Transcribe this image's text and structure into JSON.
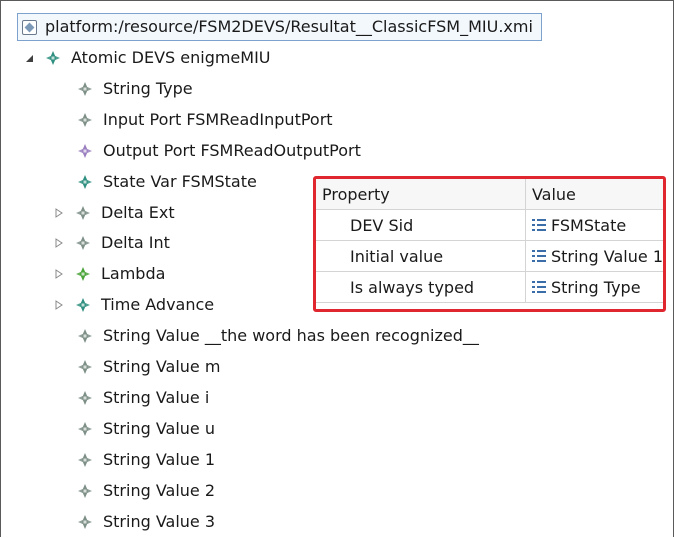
{
  "resource": {
    "icon": "resource-file-icon",
    "label": "platform:/resource/FSM2DEVS/Resultat__ClassicFSM_MIU.xmi"
  },
  "tree": {
    "root": {
      "twisty": "expanded",
      "icon": "diamond-node-icon",
      "label": "Atomic DEVS enigmeMIU"
    },
    "children": [
      {
        "twisty": "none",
        "icon": "diamond-node-icon",
        "color": "#7d8f86",
        "label": "String Type"
      },
      {
        "twisty": "none",
        "icon": "diamond-node-icon",
        "color": "#7d8f86",
        "label": "Input Port FSMReadInputPort"
      },
      {
        "twisty": "none",
        "icon": "diamond-node-icon",
        "color": "#9a7fc0",
        "label": "Output Port FSMReadOutputPort"
      },
      {
        "twisty": "none",
        "icon": "diamond-node-icon",
        "color": "#2f8f80",
        "label": "State Var FSMState"
      },
      {
        "twisty": "collapsed",
        "icon": "diamond-node-icon",
        "color": "#7d8f86",
        "label": "Delta Ext"
      },
      {
        "twisty": "collapsed",
        "icon": "diamond-node-icon",
        "color": "#7d8f86",
        "label": "Delta Int"
      },
      {
        "twisty": "collapsed",
        "icon": "diamond-node-icon",
        "color": "#4aa43a",
        "label": "Lambda"
      },
      {
        "twisty": "collapsed",
        "icon": "diamond-node-icon",
        "color": "#2f8f80",
        "label": "Time Advance"
      },
      {
        "twisty": "none",
        "icon": "diamond-node-icon",
        "color": "#7d8f86",
        "label": "String Value __the word has been recognized__"
      },
      {
        "twisty": "none",
        "icon": "diamond-node-icon",
        "color": "#7d8f86",
        "label": "String Value m"
      },
      {
        "twisty": "none",
        "icon": "diamond-node-icon",
        "color": "#7d8f86",
        "label": "String Value i"
      },
      {
        "twisty": "none",
        "icon": "diamond-node-icon",
        "color": "#7d8f86",
        "label": "String Value u"
      },
      {
        "twisty": "none",
        "icon": "diamond-node-icon",
        "color": "#7d8f86",
        "label": "String Value 1"
      },
      {
        "twisty": "none",
        "icon": "diamond-node-icon",
        "color": "#7d8f86",
        "label": "String Value 2"
      },
      {
        "twisty": "none",
        "icon": "diamond-node-icon",
        "color": "#7d8f86",
        "label": "String Value 3"
      }
    ]
  },
  "properties": {
    "headers": {
      "property": "Property",
      "value": "Value"
    },
    "rows": [
      {
        "key": "DEV Sid",
        "value": "FSMState",
        "icon": "list-item-icon"
      },
      {
        "key": "Initial value",
        "value": "String Value 1",
        "icon": "list-item-icon"
      },
      {
        "key": "Is always typed",
        "value": "String Type",
        "icon": "list-item-icon"
      }
    ],
    "highlight_color": "#e0262e"
  }
}
